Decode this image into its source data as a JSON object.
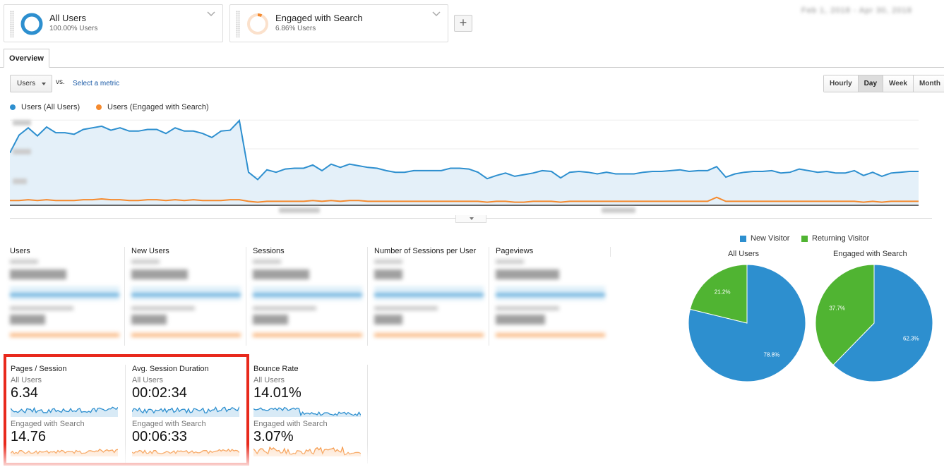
{
  "segments": [
    {
      "title": "All Users",
      "subtitle": "100.00% Users",
      "color": "#2d8fcf"
    },
    {
      "title": "Engaged with Search",
      "subtitle": "6.86% Users",
      "color": "#f58a2e"
    }
  ],
  "add_segment_label": "+",
  "date_range": "Feb 1, 2018 - Apr 30, 2018",
  "tabs": [
    {
      "label": "Overview"
    }
  ],
  "metric_selector": {
    "value": "Users",
    "vs_label": "vs.",
    "select_metric_label": "Select a metric"
  },
  "time_buttons": [
    {
      "label": "Hourly"
    },
    {
      "label": "Day",
      "active": true
    },
    {
      "label": "Week"
    },
    {
      "label": "Month"
    }
  ],
  "chart_data": {
    "type": "line",
    "series": [
      {
        "name": "Users (All Users)",
        "color": "#2d8fcf",
        "values": [
          64,
          86,
          95,
          85,
          96,
          89,
          89,
          87,
          93,
          95,
          97,
          92,
          95,
          91,
          91,
          93,
          93,
          88,
          95,
          91,
          91,
          88,
          83,
          91,
          92,
          104,
          40,
          31,
          43,
          40,
          44,
          45,
          45,
          49,
          42,
          50,
          46,
          50,
          48,
          46,
          45,
          42,
          40,
          40,
          42,
          42,
          42,
          42,
          45,
          45,
          44,
          40,
          32,
          36,
          39,
          35,
          37,
          39,
          42,
          41,
          33,
          40,
          41,
          40,
          38,
          40,
          38,
          38,
          38,
          40,
          41,
          41,
          42,
          43,
          41,
          42,
          42,
          47,
          34,
          38,
          40,
          41,
          41,
          42,
          39,
          40,
          44,
          42,
          40,
          41,
          39,
          39,
          42,
          36,
          40,
          35,
          39,
          40,
          41,
          41
        ]
      },
      {
        "name": "Users (Engaged with Search)",
        "color": "#f58a2e",
        "values": [
          5,
          5,
          6,
          5,
          6,
          5,
          5,
          5,
          6,
          6,
          7,
          6,
          6,
          5,
          5,
          6,
          6,
          5,
          6,
          5,
          6,
          5,
          5,
          5,
          6,
          6,
          4,
          3,
          4,
          4,
          4,
          4,
          4,
          5,
          4,
          5,
          4,
          5,
          5,
          4,
          4,
          4,
          4,
          4,
          4,
          4,
          4,
          4,
          4,
          4,
          4,
          4,
          3,
          4,
          4,
          3,
          3,
          4,
          4,
          4,
          3,
          4,
          4,
          4,
          4,
          4,
          4,
          4,
          4,
          4,
          4,
          4,
          4,
          4,
          4,
          4,
          4,
          9,
          4,
          4,
          4,
          4,
          4,
          4,
          4,
          4,
          4,
          4,
          4,
          4,
          4,
          4,
          4,
          3,
          4,
          3,
          4,
          4,
          4,
          4
        ]
      }
    ],
    "ylim": [
      0,
      110
    ]
  },
  "scorecards": [
    {
      "title": "Users"
    },
    {
      "title": "New Users"
    },
    {
      "title": "Sessions"
    },
    {
      "title": "Number of Sessions per User"
    },
    {
      "title": "Pageviews"
    },
    {
      "title": "Pages / Session",
      "seg1_label": "All Users",
      "seg1_value": "6.34",
      "seg2_label": "Engaged with Search",
      "seg2_value": "14.76"
    },
    {
      "title": "Avg. Session Duration",
      "seg1_label": "All Users",
      "seg1_value": "00:02:34",
      "seg2_label": "Engaged with Search",
      "seg2_value": "00:06:33"
    },
    {
      "title": "Bounce Rate",
      "seg1_label": "All Users",
      "seg1_value": "14.01%",
      "seg2_label": "Engaged with Search",
      "seg2_value": "3.07%"
    }
  ],
  "pie_legend": [
    {
      "label": "New Visitor",
      "color": "#2d8fcf"
    },
    {
      "label": "Returning Visitor",
      "color": "#50b432"
    }
  ],
  "pies": [
    {
      "title": "All Users",
      "slices": [
        {
          "label": "78.8%",
          "value": 78.8,
          "color": "#2d8fcf"
        },
        {
          "label": "21.2%",
          "value": 21.2,
          "color": "#50b432"
        }
      ]
    },
    {
      "title": "Engaged with Search",
      "slices": [
        {
          "label": "62.3%",
          "value": 62.3,
          "color": "#2d8fcf"
        },
        {
          "label": "37.7%",
          "value": 37.7,
          "color": "#50b432"
        }
      ]
    }
  ],
  "icons": {
    "segment_menu": "chevron-down-icon",
    "dropdown": "caret-down-icon",
    "collapse": "caret-down-icon"
  }
}
